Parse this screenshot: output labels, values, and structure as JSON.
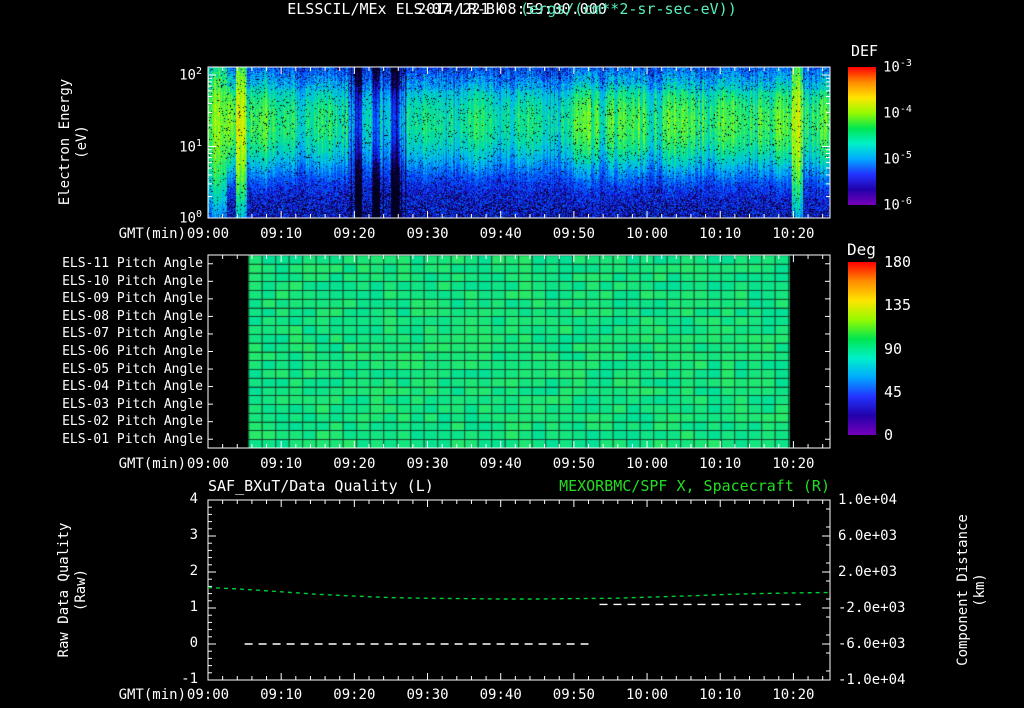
{
  "colors": {
    "background": "#000000",
    "text": "#ffffff",
    "units_text": "#55eec0",
    "green": "#22dd22",
    "axis": "#ffffff",
    "rainbow_stops": [
      "#ff0000",
      "#ff8c00",
      "#ffe400",
      "#96fa00",
      "#00e650",
      "#00f0c8",
      "#00aaff",
      "#2233ff",
      "#2200aa",
      "#7700bb"
    ]
  },
  "header": {
    "datetime": "2014/221 08:59:00.000",
    "title": "ELSSCIL/MEx ELS-07 LR-Bk",
    "units": "(ergs/(cm**2-sr-sec-eV))"
  },
  "time_axis": {
    "label": "GMT(min)",
    "tick_labels": [
      "09:00",
      "09:10",
      "09:20",
      "09:30",
      "09:40",
      "09:50",
      "10:00",
      "10:10",
      "10:20"
    ],
    "tick_minutes": [
      0,
      10,
      20,
      30,
      40,
      50,
      60,
      70,
      80
    ],
    "range_minutes": [
      0,
      85
    ]
  },
  "spectrogram": {
    "ylabel_lines": [
      "Electron Energy",
      "(eV)"
    ],
    "ytick_labels": [
      "10^2",
      "10^1",
      "10^0"
    ],
    "colorbar_label": "DEF",
    "colorbar_ticks": [
      "10^-3",
      "10^-4",
      "10^-5",
      "10^-6"
    ]
  },
  "pitch": {
    "row_labels": [
      "ELS-11 Pitch Angle",
      "ELS-10 Pitch Angle",
      "ELS-09 Pitch Angle",
      "ELS-08 Pitch Angle",
      "ELS-07 Pitch Angle",
      "ELS-06 Pitch Angle",
      "ELS-05 Pitch Angle",
      "ELS-04 Pitch Angle",
      "ELS-03 Pitch Angle",
      "ELS-02 Pitch Angle",
      "ELS-01 Pitch Angle"
    ],
    "colorbar_label": "Deg",
    "colorbar_ticks": [
      "180",
      "135",
      "90",
      "45",
      "0"
    ]
  },
  "bottom": {
    "left_title": "SAF_BXuT/Data Quality (L)",
    "right_title": "MEXORBMC/SPF X, Spacecraft (R)",
    "left_ylabel_lines": [
      "Raw Data Quality",
      "(Raw)"
    ],
    "right_ylabel_lines": [
      "Component Distance",
      "(km)"
    ],
    "left_tick_labels": [
      "4",
      "3",
      "2",
      "1",
      "0",
      "-1"
    ],
    "right_tick_labels": [
      "1.0e+04",
      "6.0e+03",
      "2.0e+03",
      "-2.0e+03",
      "-6.0e+03",
      "-1.0e+04"
    ]
  },
  "chart_data": [
    {
      "type": "heatmap",
      "name": "electron-energy-spectrogram",
      "title": "ELSSCIL/MEx ELS-07 LR-Bk",
      "units": "ergs/(cm**2-sr-sec-eV)",
      "x_axis": {
        "label": "GMT(min)",
        "start": "09:00",
        "end": "10:25"
      },
      "y_axis": {
        "label": "Electron Energy (eV)",
        "scale": "log",
        "min": 1,
        "max": 130
      },
      "z_axis": {
        "label": "DEF",
        "scale": "log",
        "min": 1e-06,
        "max": 0.001
      },
      "band_center_eV": 22,
      "band_sigma_decades": 0.46,
      "background_def_level": 1.5e-06,
      "intensity_segments": [
        {
          "start_min": 0,
          "end_min": 8,
          "def_level": 6e-05
        },
        {
          "start_min": 8,
          "end_min": 19,
          "def_level": 2.5e-05
        },
        {
          "start_min": 19,
          "end_min": 27,
          "def_level": 1.2e-05
        },
        {
          "start_min": 27,
          "end_min": 50,
          "def_level": 2e-05
        },
        {
          "start_min": 50,
          "end_min": 85,
          "def_level": 4e-05
        }
      ],
      "bright_streaks_min": [
        4.5,
        80.5
      ],
      "dark_streaks_min": [
        20.5,
        23,
        25.5
      ]
    },
    {
      "type": "heatmap",
      "name": "pitch-angle-panel",
      "rows": [
        "ELS-11",
        "ELS-10",
        "ELS-09",
        "ELS-08",
        "ELS-07",
        "ELS-06",
        "ELS-05",
        "ELS-04",
        "ELS-03",
        "ELS-02",
        "ELS-01"
      ],
      "z_axis": {
        "label": "Deg",
        "min": 0,
        "max": 180
      },
      "value_deg": 95,
      "data_start_min": 5.5,
      "data_end_min": 79.5
    },
    {
      "type": "line",
      "name": "quality-and-distance",
      "x_axis": {
        "label": "GMT(min)",
        "start": "09:00",
        "end": "10:25"
      },
      "left_axis": {
        "label": "Raw Data Quality (Raw)",
        "min": -1,
        "max": 4
      },
      "right_axis": {
        "label": "Component Distance (km)",
        "min": -10000,
        "max": 10000
      },
      "series": [
        {
          "name": "SAF_BXuT/Data Quality (L)",
          "axis": "left",
          "color": "#ffffff",
          "line_style": "dashed",
          "segments": [
            {
              "start_min": 5,
              "end_min": 52,
              "value": 0
            },
            {
              "start_min": 53.5,
              "end_min": 81,
              "value": 1.1
            }
          ]
        },
        {
          "name": "MEXORBMC/SPF X, Spacecraft (R)",
          "axis": "right",
          "color": "#00cc33",
          "line_style": "dashed",
          "x_min": [
            0,
            5,
            10,
            15,
            20,
            25,
            30,
            35,
            40,
            45,
            50,
            55,
            60,
            65,
            70,
            75,
            80,
            85
          ],
          "km": [
            280,
            80,
            -200,
            -480,
            -680,
            -840,
            -920,
            -960,
            -1000,
            -1000,
            -960,
            -920,
            -800,
            -680,
            -520,
            -400,
            -320,
            -280
          ]
        }
      ]
    }
  ]
}
